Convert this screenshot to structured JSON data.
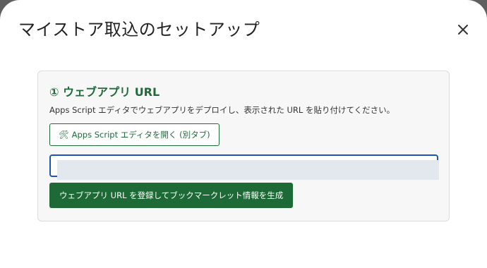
{
  "dialog": {
    "title": "マイストア取込のセットアップ",
    "close_icon": "close-icon"
  },
  "step1": {
    "heading": "① ウェブアプリ URL",
    "description": "Apps Script エディタでウェブアプリをデプロイし、表示された URL を貼り付けてください。",
    "open_editor": {
      "icon": "tools-icon",
      "icon_glyph": "🛠",
      "label": "Apps Script エディタを開く (別タブ)"
    },
    "url_input": {
      "value": "",
      "placeholder": ""
    },
    "register_button_label": "ウェブアプリ URL を登録してブックマークレット情報を生成"
  },
  "colors": {
    "accent_green": "#1d6a36",
    "heading_green": "#1f6b3a",
    "focus_blue": "#1a56b8"
  }
}
